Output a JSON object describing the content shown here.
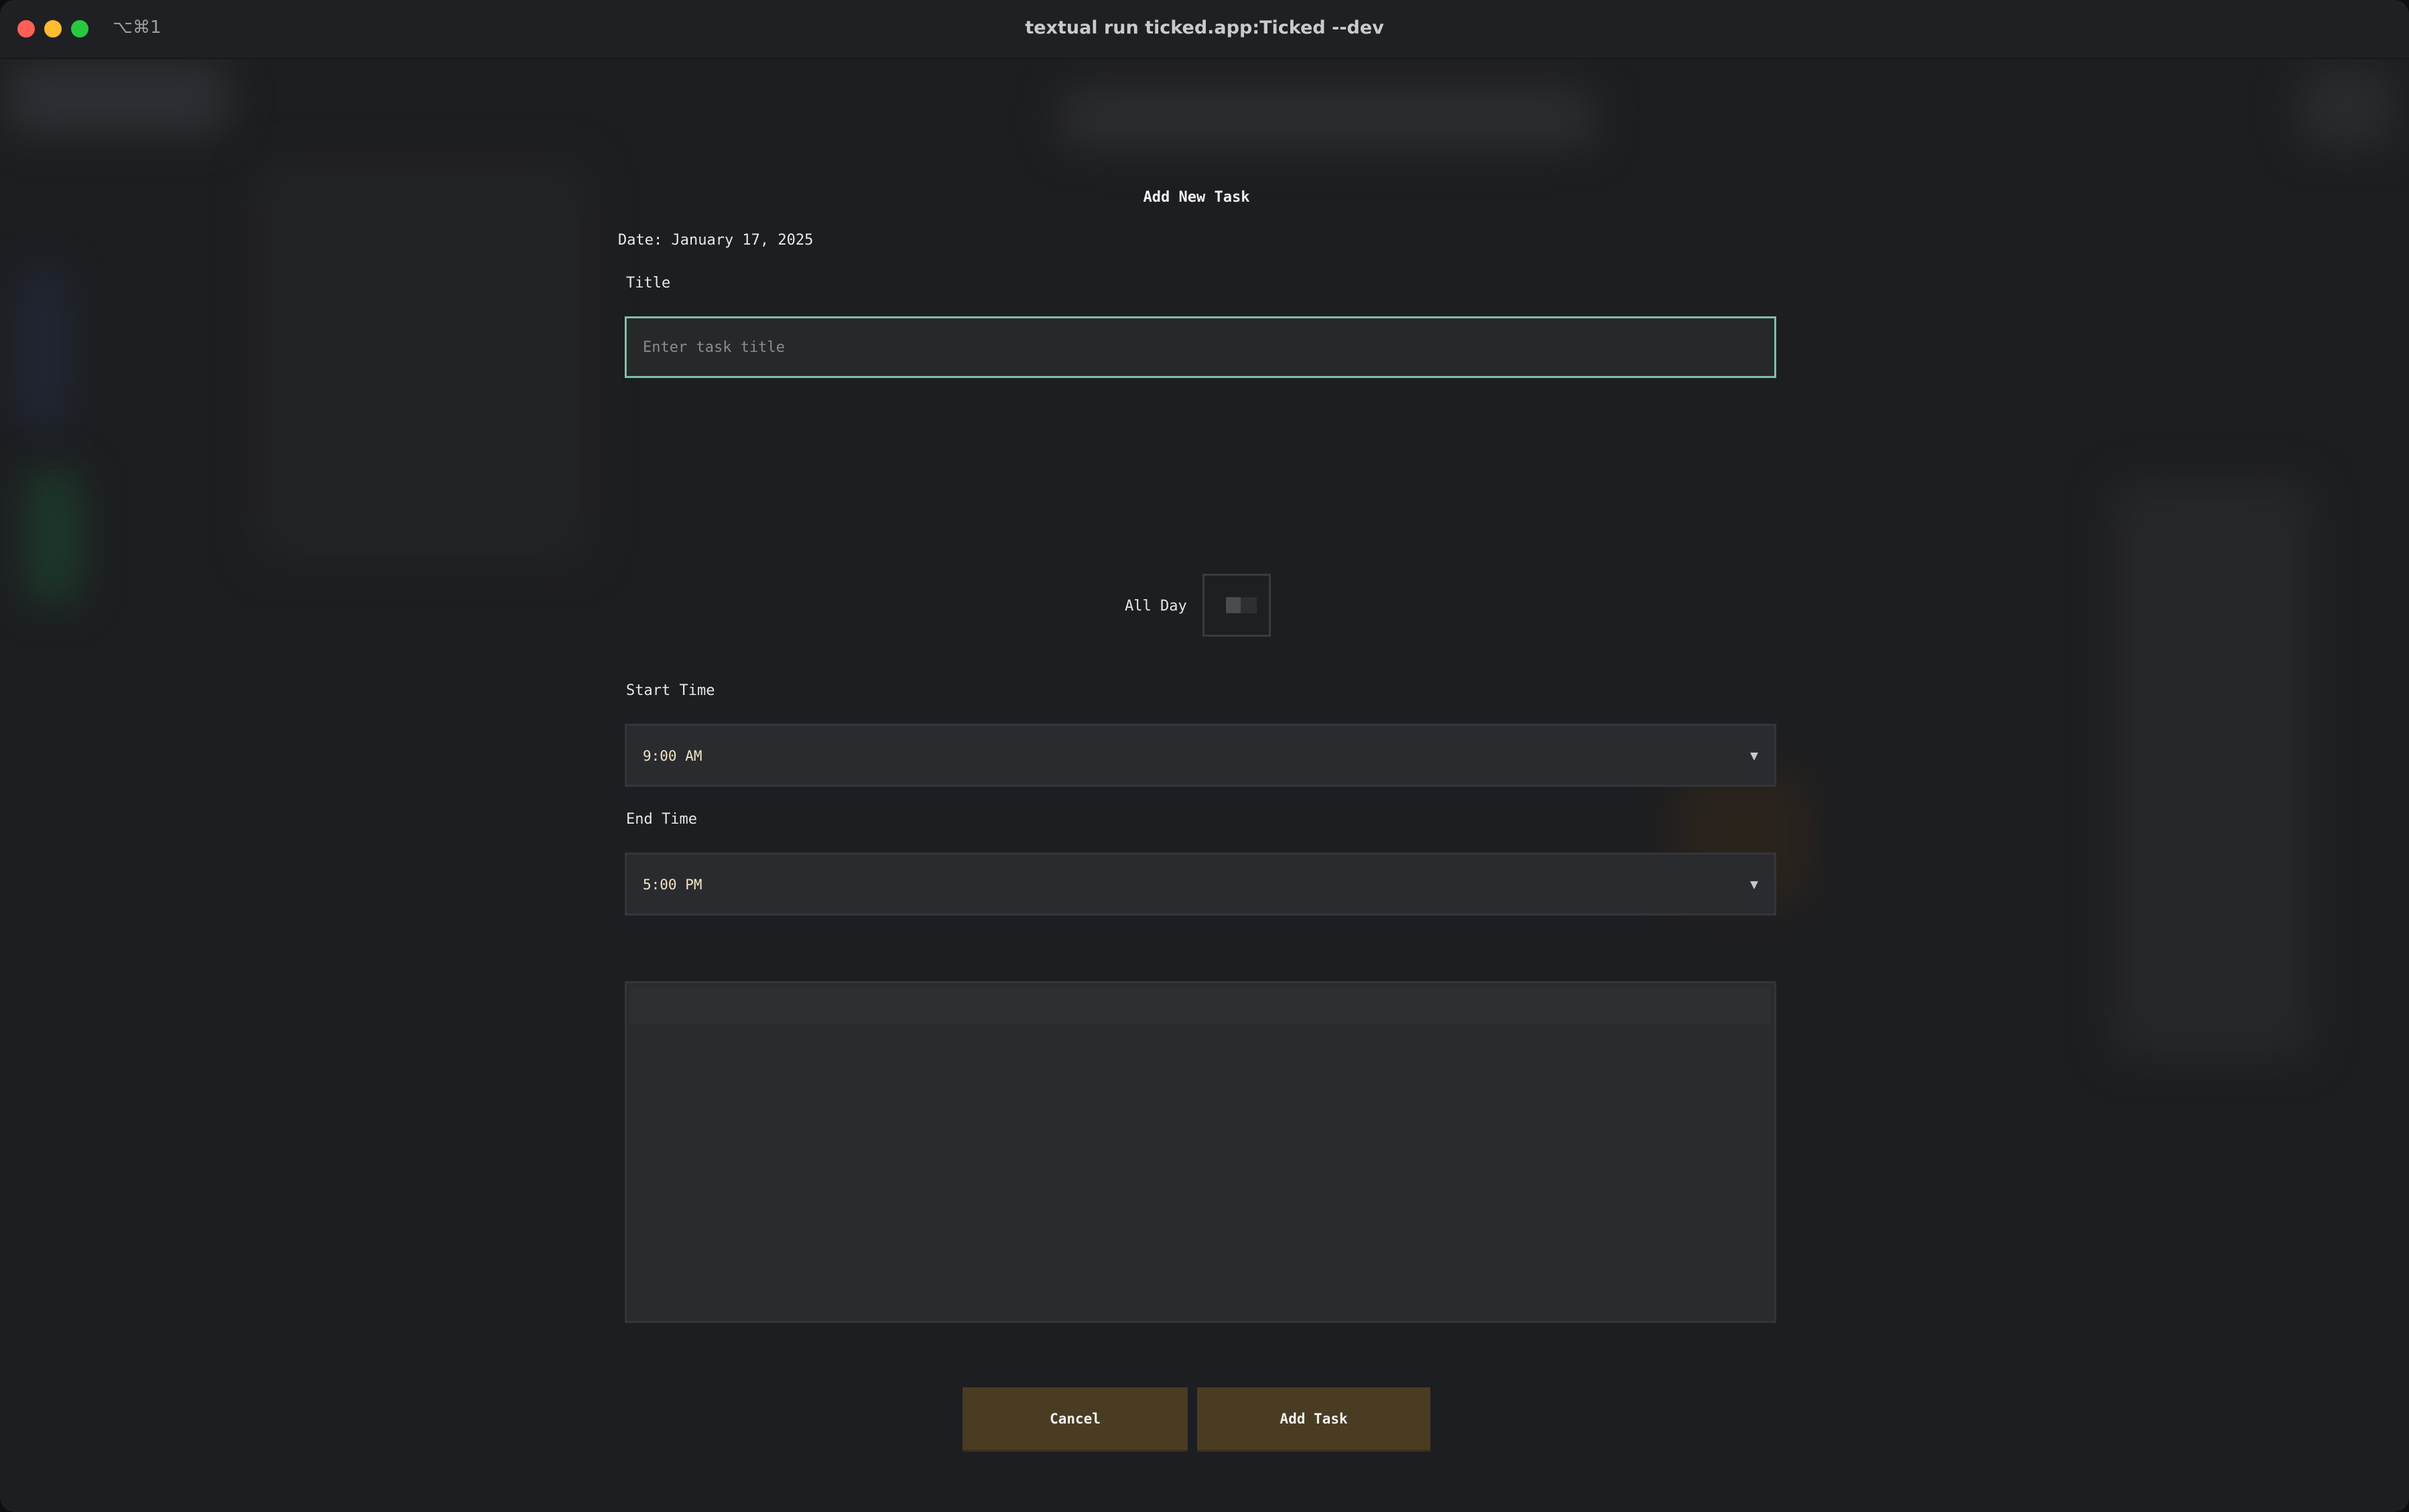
{
  "window": {
    "title": "textual run ticked.app:Ticked --dev",
    "shortcut": "⌥⌘1"
  },
  "dialog": {
    "heading": "Add New Task",
    "date_line": "Date: January 17, 2025",
    "title_label": "Title",
    "title_value": "",
    "title_placeholder": "Enter task title",
    "all_day_label": "All Day",
    "all_day_checked": false,
    "start_label": "Start Time",
    "start_value": "9:00 AM",
    "end_label": "End Time",
    "end_value": "5:00 PM",
    "description_value": "",
    "cancel_label": "Cancel",
    "add_label": "Add Task"
  },
  "icons": {
    "dropdown": "chevron-down-icon",
    "close": "close-icon",
    "minimize": "minimize-icon",
    "maximize": "maximize-icon"
  },
  "colors": {
    "focus_border": "#7dbfa6",
    "button_bg": "#4a3c22",
    "window_bg": "#1d1e21"
  }
}
